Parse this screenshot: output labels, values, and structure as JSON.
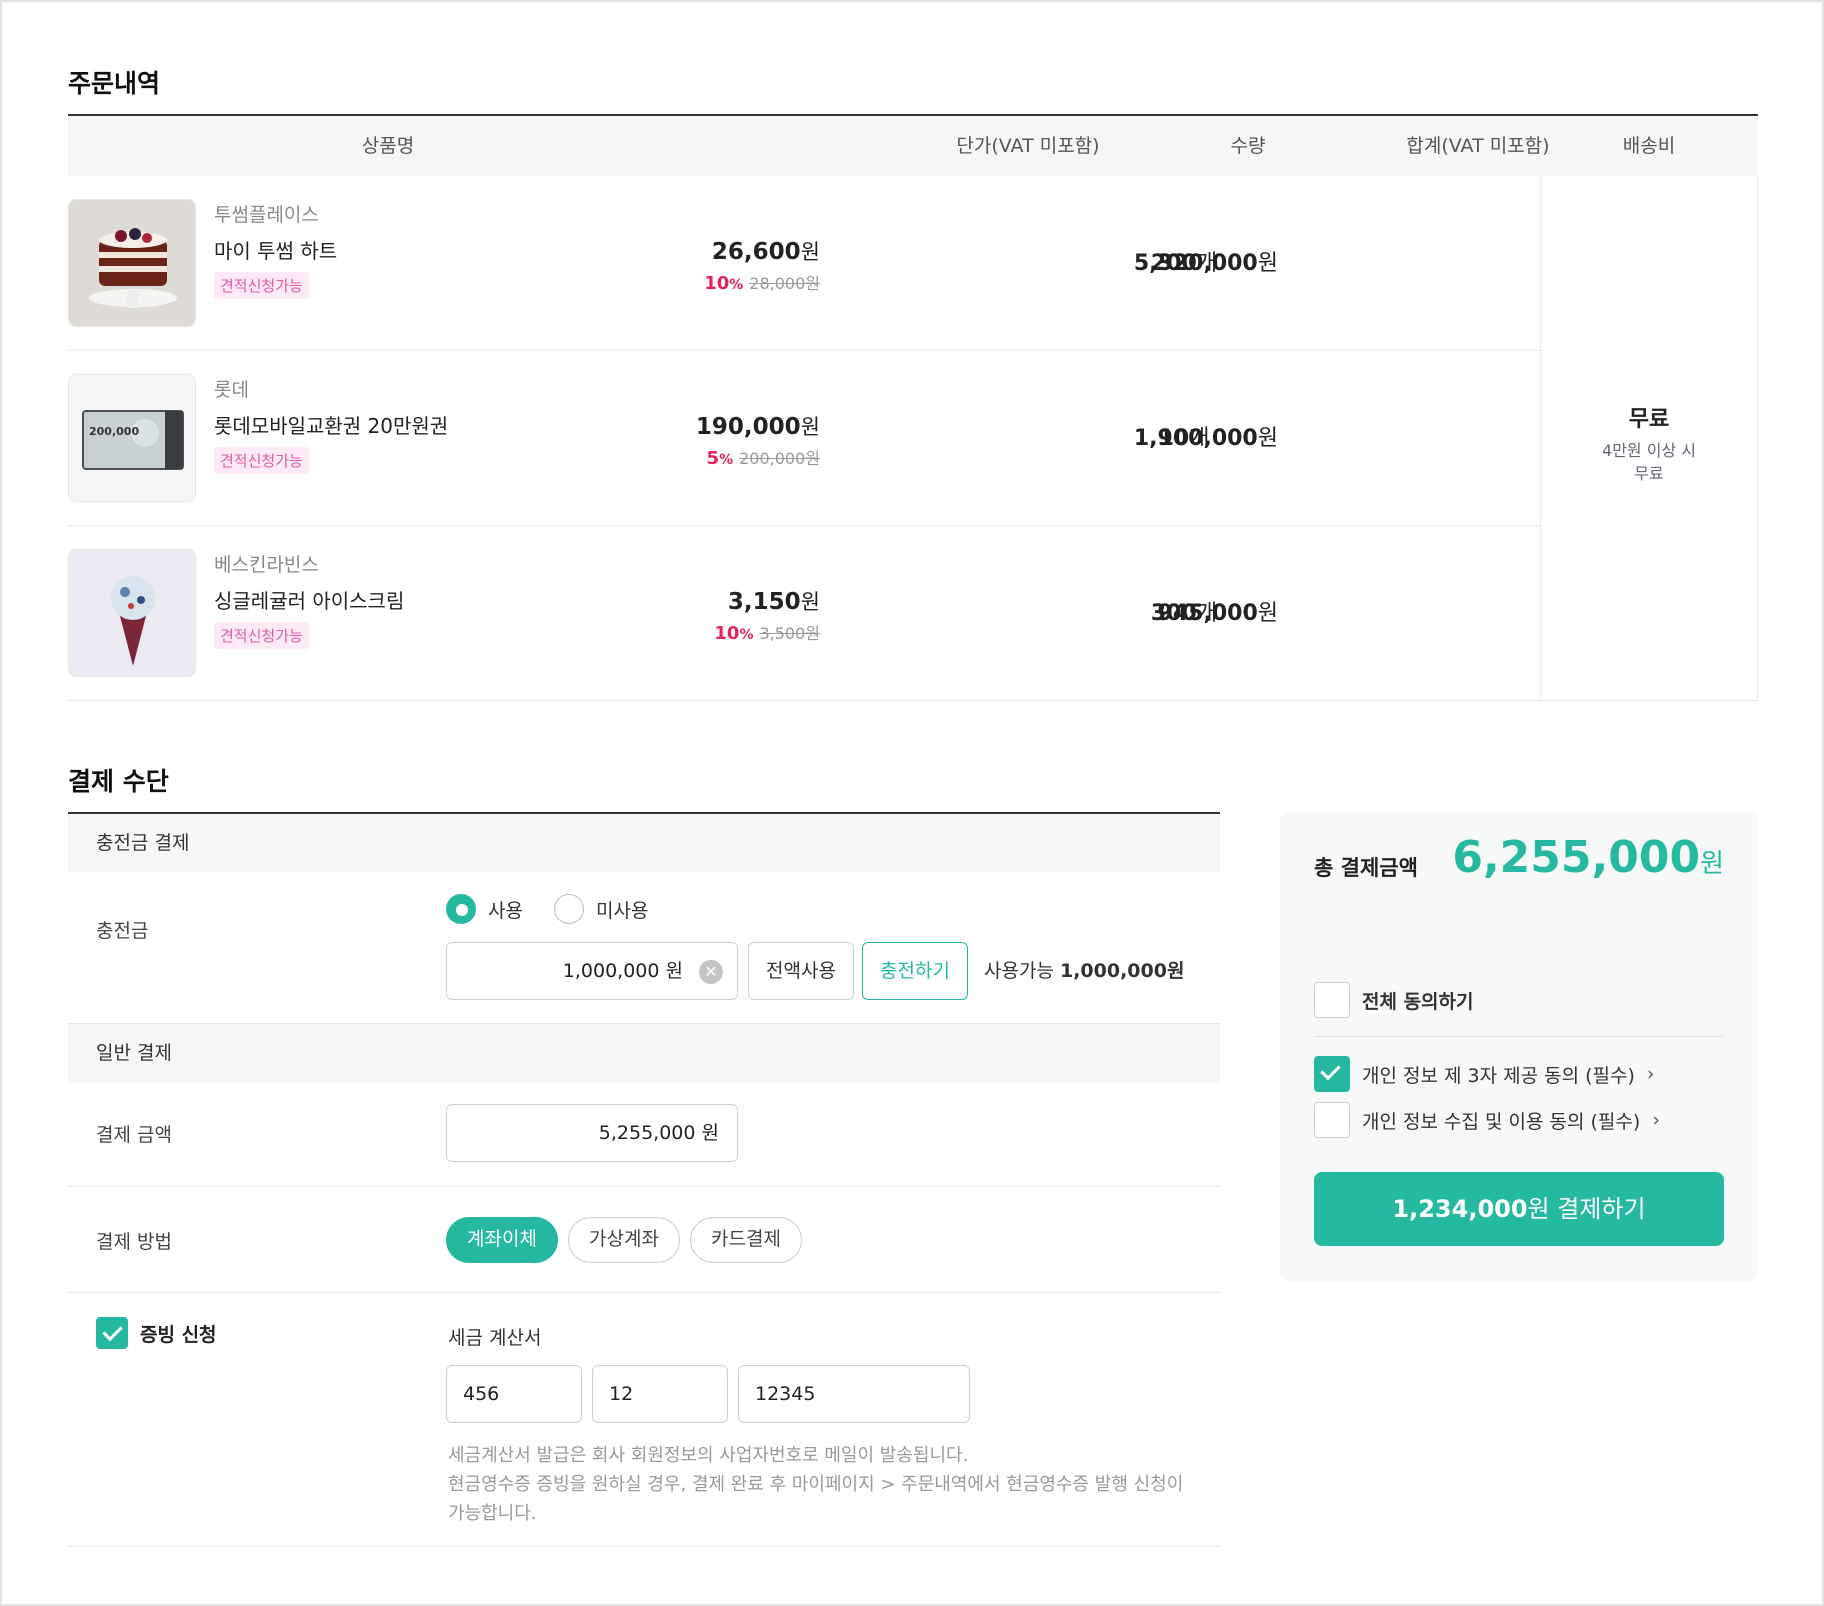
{
  "order": {
    "title": "주문내역",
    "headers": {
      "product": "상품명",
      "unit_price": "단가(VAT 미포함)",
      "quantity": "수량",
      "total": "합계(VAT 미포함)",
      "shipping": "배송비"
    },
    "items": [
      {
        "brand": "투썸플레이스",
        "name": "마이 투썸 하트",
        "badge": "견적신청가능",
        "price": "26,600",
        "price_unit": "원",
        "discount_num": "10",
        "discount_sym": "%",
        "original_price": "28,000원",
        "qty": "200",
        "qty_unit": "개",
        "total": "5,320,000",
        "total_unit": "원"
      },
      {
        "brand": "롯데",
        "name": "롯데모바일교환권 20만원권",
        "badge": "견적신청가능",
        "price": "190,000",
        "price_unit": "원",
        "discount_num": "5",
        "discount_sym": "%",
        "original_price": "200,000원",
        "qty": "10",
        "qty_unit": "개",
        "total": "1,900,000",
        "total_unit": "원",
        "thumb_text": "200,000"
      },
      {
        "brand": "베스킨라빈스",
        "name": "싱글레귤러 아이스크림",
        "badge": "견적신청가능",
        "price": "3,150",
        "price_unit": "원",
        "discount_num": "10",
        "discount_sym": "%",
        "original_price": "3,500원",
        "qty": "300",
        "qty_unit": "개",
        "total": "945,000",
        "total_unit": "원"
      }
    ],
    "shipping": {
      "main": "무료",
      "note_line1": "4만원 이상 시",
      "note_line2": "무료"
    }
  },
  "payment": {
    "title": "결제 수단",
    "charge_band": "충전금 결제",
    "charge_label": "충전금",
    "radio_use": "사용",
    "radio_nouse": "미사용",
    "charge_value": "1,000,000 원",
    "use_all_button": "전액사용",
    "charge_button": "충전하기",
    "available_label": "사용가능",
    "available_amount": "1,000,000원",
    "general_band": "일반 결제",
    "amount_label": "결제 금액",
    "amount_value": "5,255,000 원",
    "method_label": "결제 방법",
    "methods": [
      "계좌이체",
      "가상계좌",
      "카드결제"
    ],
    "receipt_label": "증빙 신청",
    "tax_invoice_label": "세금 계산서",
    "biz_no": [
      "456",
      "12",
      "12345"
    ],
    "notes": [
      "세금계산서 발급은 회사 회원정보의 사업자번호로 메일이 발송됩니다.",
      "현금영수증 증빙을 원하실 경우, 결제 완료 후 마이페이지 > 주문내역에서 현금영수증 발행 신청이",
      "가능합니다."
    ]
  },
  "summary": {
    "label": "총 결제금액",
    "amount": "6,255,000",
    "unit": "원",
    "agree_all": "전체 동의하기",
    "agree_third": "개인 정보 제 3자 제공 동의 (필수)",
    "agree_collect": "개인 정보 수집 및 이용 동의 (필수)",
    "pay_amount": "1,234,000",
    "pay_suffix": "원 결제하기"
  },
  "colors": {
    "accent": "#26b9a2",
    "discount": "#e3245a",
    "badge": "#e05aa8"
  }
}
